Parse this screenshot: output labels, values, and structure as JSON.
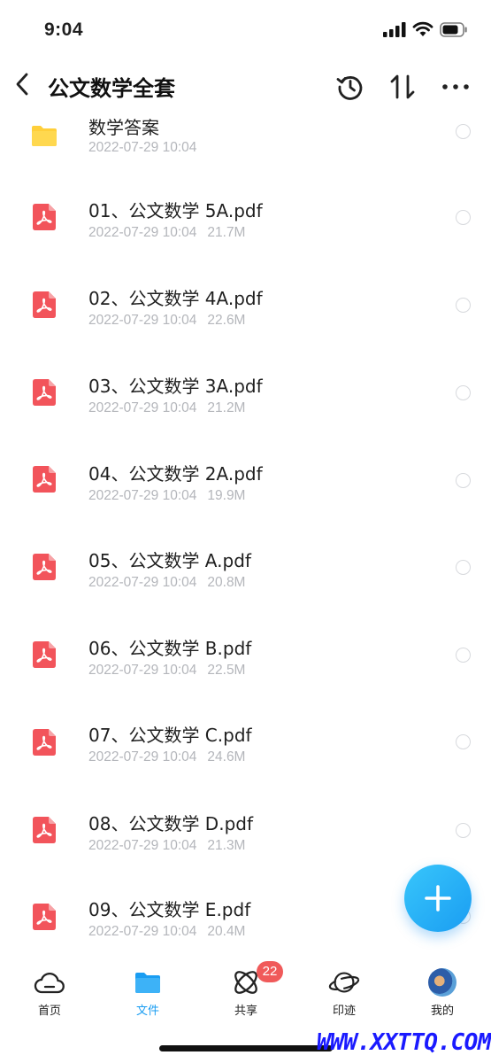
{
  "status_bar": {
    "time": "9:04"
  },
  "nav": {
    "title": "公文数学全套"
  },
  "files": [
    {
      "name": "数学答案",
      "date": "2022-07-29 10:04",
      "size": "",
      "type": "folder"
    },
    {
      "name": "01、公文数学 5A.pdf",
      "date": "2022-07-29 10:04",
      "size": "21.7M",
      "type": "pdf"
    },
    {
      "name": "02、公文数学 4A.pdf",
      "date": "2022-07-29 10:04",
      "size": "22.6M",
      "type": "pdf"
    },
    {
      "name": "03、公文数学 3A.pdf",
      "date": "2022-07-29 10:04",
      "size": "21.2M",
      "type": "pdf"
    },
    {
      "name": "04、公文数学 2A.pdf",
      "date": "2022-07-29 10:04",
      "size": "19.9M",
      "type": "pdf"
    },
    {
      "name": "05、公文数学 A.pdf",
      "date": "2022-07-29 10:04",
      "size": "20.8M",
      "type": "pdf"
    },
    {
      "name": "06、公文数学 B.pdf",
      "date": "2022-07-29 10:04",
      "size": "22.5M",
      "type": "pdf"
    },
    {
      "name": "07、公文数学 C.pdf",
      "date": "2022-07-29 10:04",
      "size": "24.6M",
      "type": "pdf"
    },
    {
      "name": "08、公文数学 D.pdf",
      "date": "2022-07-29 10:04",
      "size": "21.3M",
      "type": "pdf"
    },
    {
      "name": "09、公文数学 E.pdf",
      "date": "2022-07-29 10:04",
      "size": "20.4M",
      "type": "pdf"
    }
  ],
  "tabs": [
    {
      "label": "首页",
      "icon": "cloud-icon",
      "active": false
    },
    {
      "label": "文件",
      "icon": "folder-icon",
      "active": true
    },
    {
      "label": "共享",
      "icon": "atom-icon",
      "active": false
    },
    {
      "label": "印迹",
      "icon": "planet-icon",
      "active": false
    },
    {
      "label": "我的",
      "icon": "avatar",
      "active": false
    }
  ],
  "share_badge": "22",
  "watermark": "WWW.XXTTQ.COM",
  "colors": {
    "accent": "#1a9df2",
    "pdf_red": "#f2545b",
    "folder_yellow": "#ffcf3a",
    "badge_red": "#f05a5a",
    "meta_gray": "#b4b6bb"
  }
}
